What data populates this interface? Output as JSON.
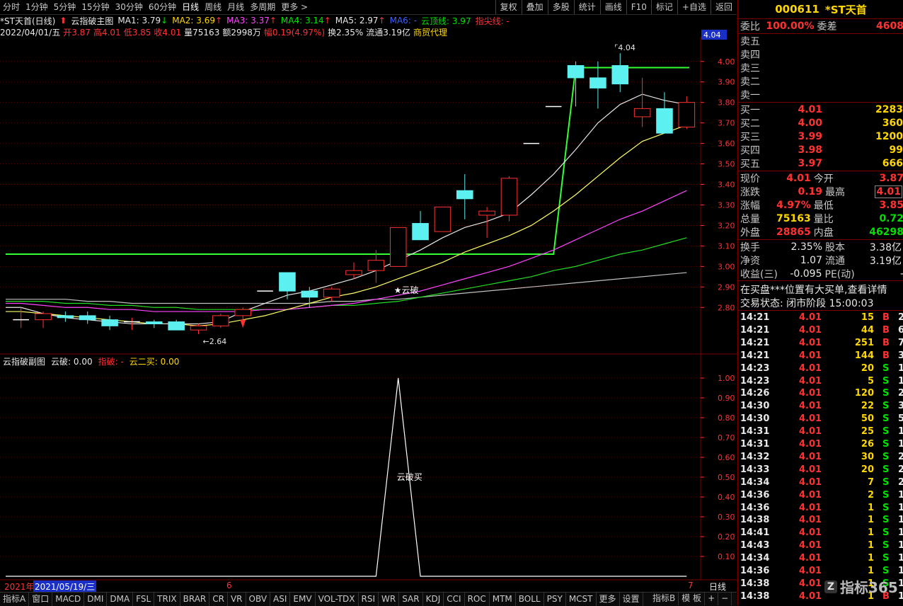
{
  "toolbar": {
    "periods": [
      "分时",
      "1分钟",
      "5分钟",
      "15分钟",
      "30分钟",
      "60分钟",
      "日线",
      "周线",
      "月线",
      "多周期",
      "更多 >"
    ],
    "active_period": "日线",
    "right_buttons": [
      "复权",
      "叠加",
      "多股",
      "统计",
      "画线",
      "F10",
      "标记",
      "+自选",
      "返回"
    ]
  },
  "main_info": {
    "title": "*ST天首(日线)",
    "indicator": "云指破主图",
    "ma1": "MA1: 3.79",
    "ma2": "MA2: 3.69",
    "ma3": "MA3: 3.37",
    "ma4": "MA4: 3.14",
    "ma5": "MA5: 2.97",
    "ma6": "MA6: -",
    "yunding": "云顶线: 3.97",
    "zhijian": "指尖线: -",
    "date": "2022/04/01/五",
    "open": "开3.87",
    "high": "高4.01",
    "low": "低3.85",
    "close": "收4.01",
    "volume": "量75163",
    "amount": "额2998万",
    "change": "幅0.19(4.97%)",
    "turnover": "换2.35%",
    "float_cap": "流通3.19亿",
    "sector": "商贸代理"
  },
  "sub_info": {
    "indicator": "云指破副图",
    "yunpo": "云破: 0.00",
    "zhipo": "指破: -",
    "yuner": "云二买: 0.00"
  },
  "colors": {
    "up": "#ff3232",
    "down": "#5cf0f0",
    "ma1": "#e8e8e8",
    "ma2": "#ffff66",
    "ma3": "#ff44ff",
    "ma4": "#22dd22",
    "ma5": "#c0c0c0",
    "cloud_top": "#33ff33"
  },
  "chart_data": [
    {
      "type": "candlestick",
      "ylim": [
        2.58,
        4.12
      ],
      "yticks": [
        "4.00",
        "3.90",
        "3.80",
        "3.70",
        "3.60",
        "3.50",
        "3.40",
        "3.30",
        "3.20",
        "3.10",
        "3.00",
        "2.90",
        "2.80"
      ],
      "ytick_values": [
        4.0,
        3.9,
        3.8,
        3.7,
        3.6,
        3.5,
        3.4,
        3.3,
        3.2,
        3.1,
        3.0,
        2.9,
        2.8
      ],
      "current_price_label": "4.04",
      "high_label": "4.04",
      "low_label": "2.64",
      "annotation": "★云破",
      "candles": [
        {
          "o": 2.74,
          "h": 2.8,
          "l": 2.7,
          "c": 2.74
        },
        {
          "o": 2.74,
          "h": 2.78,
          "l": 2.7,
          "c": 2.77
        },
        {
          "o": 2.76,
          "h": 2.78,
          "l": 2.73,
          "c": 2.75
        },
        {
          "o": 2.76,
          "h": 2.78,
          "l": 2.72,
          "c": 2.74
        },
        {
          "o": 2.74,
          "h": 2.76,
          "l": 2.69,
          "c": 2.71
        },
        {
          "o": 2.73,
          "h": 2.75,
          "l": 2.69,
          "c": 2.73
        },
        {
          "o": 2.73,
          "h": 2.74,
          "l": 2.7,
          "c": 2.72
        },
        {
          "o": 2.73,
          "h": 2.74,
          "l": 2.69,
          "c": 2.69
        },
        {
          "o": 2.69,
          "h": 2.72,
          "l": 2.67,
          "c": 2.71
        },
        {
          "o": 2.71,
          "h": 2.77,
          "l": 2.7,
          "c": 2.76
        },
        {
          "o": 2.76,
          "h": 2.8,
          "l": 2.73,
          "c": 2.79
        },
        {
          "o": 2.88,
          "h": 2.88,
          "l": 2.88,
          "c": 2.88
        },
        {
          "o": 2.97,
          "h": 2.97,
          "l": 2.84,
          "c": 2.88
        },
        {
          "o": 2.88,
          "h": 2.9,
          "l": 2.8,
          "c": 2.85
        },
        {
          "o": 2.85,
          "h": 2.9,
          "l": 2.83,
          "c": 2.89
        },
        {
          "o": 2.96,
          "h": 3.02,
          "l": 2.94,
          "c": 2.98
        },
        {
          "o": 2.98,
          "h": 3.08,
          "l": 2.92,
          "c": 3.03
        },
        {
          "o": 3.0,
          "h": 3.19,
          "l": 3.0,
          "c": 3.19
        },
        {
          "o": 3.21,
          "h": 3.27,
          "l": 3.13,
          "c": 3.13
        },
        {
          "o": 3.17,
          "h": 3.29,
          "l": 3.17,
          "c": 3.29
        },
        {
          "o": 3.37,
          "h": 3.45,
          "l": 3.23,
          "c": 3.33
        },
        {
          "o": 3.25,
          "h": 3.29,
          "l": 3.14,
          "c": 3.27
        },
        {
          "o": 3.25,
          "h": 3.44,
          "l": 3.22,
          "c": 3.43
        },
        {
          "o": 3.6,
          "h": 3.6,
          "l": 3.6,
          "c": 3.6
        },
        {
          "o": 3.78,
          "h": 3.78,
          "l": 3.78,
          "c": 3.78
        },
        {
          "o": 3.98,
          "h": 4.0,
          "l": 3.78,
          "c": 3.92
        },
        {
          "o": 3.92,
          "h": 4.0,
          "l": 3.77,
          "c": 3.87
        },
        {
          "o": 3.98,
          "h": 4.04,
          "l": 3.85,
          "c": 3.89
        },
        {
          "o": 3.73,
          "h": 3.92,
          "l": 3.68,
          "c": 3.77
        },
        {
          "o": 3.77,
          "h": 3.85,
          "l": 3.66,
          "c": 3.65
        },
        {
          "o": 3.68,
          "h": 3.83,
          "l": 3.67,
          "c": 3.8
        }
      ],
      "ma1": [
        2.8,
        2.77,
        2.75,
        2.74,
        2.73,
        2.72,
        2.72,
        2.72,
        2.72,
        2.73,
        2.78,
        2.82,
        2.86,
        2.88,
        2.91,
        2.94,
        2.98,
        3.03,
        3.08,
        3.14,
        3.19,
        3.22,
        3.26,
        3.35,
        3.45,
        3.57,
        3.7,
        3.79,
        3.84,
        3.81,
        3.79
      ],
      "ma2": [
        2.78,
        2.77,
        2.76,
        2.75,
        2.74,
        2.73,
        2.72,
        2.72,
        2.71,
        2.72,
        2.74,
        2.76,
        2.79,
        2.82,
        2.85,
        2.87,
        2.9,
        2.94,
        2.98,
        3.02,
        3.07,
        3.11,
        3.15,
        3.2,
        3.27,
        3.35,
        3.44,
        3.53,
        3.61,
        3.65,
        3.69
      ],
      "ma3": [
        2.82,
        2.81,
        2.8,
        2.8,
        2.79,
        2.79,
        2.78,
        2.78,
        2.78,
        2.78,
        2.78,
        2.79,
        2.79,
        2.8,
        2.81,
        2.82,
        2.84,
        2.86,
        2.88,
        2.91,
        2.94,
        2.97,
        3.0,
        3.04,
        3.08,
        3.13,
        3.18,
        3.23,
        3.27,
        3.32,
        3.37
      ],
      "ma4": [
        2.83,
        2.83,
        2.82,
        2.82,
        2.81,
        2.81,
        2.8,
        2.8,
        2.79,
        2.79,
        2.79,
        2.79,
        2.79,
        2.8,
        2.81,
        2.81,
        2.82,
        2.83,
        2.85,
        2.87,
        2.89,
        2.91,
        2.93,
        2.95,
        2.98,
        3.0,
        3.03,
        3.06,
        3.08,
        3.11,
        3.14
      ],
      "ma5": [
        2.84,
        2.84,
        2.84,
        2.83,
        2.83,
        2.82,
        2.82,
        2.82,
        2.82,
        2.82,
        2.82,
        2.82,
        2.82,
        2.82,
        2.83,
        2.83,
        2.84,
        2.84,
        2.85,
        2.86,
        2.87,
        2.88,
        2.89,
        2.9,
        2.91,
        2.92,
        2.93,
        2.94,
        2.95,
        2.96,
        2.97
      ],
      "cloud_top": [
        3.06,
        3.06,
        3.06,
        3.06,
        3.06,
        3.06,
        3.06,
        3.06,
        3.06,
        3.06,
        3.06,
        3.06,
        3.06,
        3.06,
        3.06,
        3.06,
        3.06,
        3.06,
        3.06,
        3.06,
        3.06,
        3.06,
        3.06,
        3.06,
        3.06,
        3.97,
        3.97,
        3.97,
        3.97,
        3.97,
        3.97
      ]
    },
    {
      "type": "line",
      "ylim": [
        0,
        1.05
      ],
      "yticks": [
        "1.00",
        "0.90",
        "0.80",
        "0.70",
        "0.60",
        "0.50",
        "0.40",
        "0.30",
        "0.20",
        "0.10"
      ],
      "ytick_values": [
        1.0,
        0.9,
        0.8,
        0.7,
        0.6,
        0.5,
        0.4,
        0.3,
        0.2,
        0.1
      ],
      "annotation": "云破买",
      "values": [
        0,
        0,
        0,
        0,
        0,
        0,
        0,
        0,
        0,
        0,
        0,
        0,
        0,
        0,
        0,
        0,
        0,
        1.0,
        0,
        0,
        0,
        0,
        0,
        0,
        0,
        0,
        0,
        0,
        0,
        0,
        0
      ]
    }
  ],
  "date_axis": {
    "labels": [
      "2021年",
      "2021/05/19/三",
      "6",
      "7"
    ],
    "tab": "日线"
  },
  "bottom_tabs": [
    "指标A",
    "窗口",
    "MACD",
    "DMI",
    "DMA",
    "FSL",
    "TRIX",
    "BRAR",
    "CR",
    "VR",
    "OBV",
    "ASI",
    "EMV",
    "VOL-TDX",
    "RSI",
    "WR",
    "SAR",
    "KDJ",
    "CCI",
    "ROC",
    "MTM",
    "BOLL",
    "PSY",
    "MCST",
    "更多",
    "设置"
  ],
  "bottom_right": [
    "指标B",
    "模 板",
    "+",
    "−"
  ],
  "panel": {
    "code": "000611",
    "name": "*ST天首",
    "weibi_label": "委比",
    "weibi": "100.00%",
    "weicha_label": "委差",
    "weicha": "4608",
    "sell": [
      {
        "label": "卖五",
        "price": "",
        "vol": ""
      },
      {
        "label": "卖四",
        "price": "",
        "vol": ""
      },
      {
        "label": "卖三",
        "price": "",
        "vol": ""
      },
      {
        "label": "卖二",
        "price": "",
        "vol": ""
      },
      {
        "label": "卖一",
        "price": "",
        "vol": ""
      }
    ],
    "buy": [
      {
        "label": "买一",
        "price": "4.01",
        "vol": "2283"
      },
      {
        "label": "买二",
        "price": "4.00",
        "vol": "360"
      },
      {
        "label": "买三",
        "price": "3.99",
        "vol": "1200"
      },
      {
        "label": "买四",
        "price": "3.98",
        "vol": "99"
      },
      {
        "label": "买五",
        "price": "3.97",
        "vol": "666"
      }
    ],
    "stats": [
      {
        "l1": "现价",
        "v1": "4.01",
        "l2": "今开",
        "v2": "3.87",
        "c1": "red",
        "c2": "red"
      },
      {
        "l1": "涨跌",
        "v1": "0.19",
        "l2": "最高",
        "v2": "4.01",
        "c1": "red",
        "c2": "red"
      },
      {
        "l1": "涨幅",
        "v1": "4.97%",
        "l2": "最低",
        "v2": "3.85",
        "c1": "red",
        "c2": "red"
      },
      {
        "l1": "总量",
        "v1": "75163",
        "l2": "量比",
        "v2": "0.72",
        "c1": "yellow",
        "c2": "green"
      },
      {
        "l1": "外盘",
        "v1": "28865",
        "l2": "内盘",
        "v2": "46298",
        "c1": "red",
        "c2": "green"
      }
    ],
    "stats2": [
      {
        "l1": "换手",
        "v1": "2.35%",
        "l2": "股本",
        "v2": "3.38亿"
      },
      {
        "l1": "净资",
        "v1": "1.07",
        "l2": "流通",
        "v2": "3.19亿"
      },
      {
        "l1": "收益(三)",
        "v1": "-0.095",
        "l2": "PE(动)",
        "v2": "-"
      }
    ],
    "message": "在买盘***位置有大买单,查看详情",
    "status": "交易状态: 闭市阶段 15:00:03",
    "ticks": [
      {
        "t": "14:21",
        "p": "4.01",
        "v": "15",
        "d": "B",
        "n": "2"
      },
      {
        "t": "14:21",
        "p": "4.01",
        "v": "44",
        "d": "B",
        "n": "6"
      },
      {
        "t": "14:21",
        "p": "4.01",
        "v": "251",
        "d": "B",
        "n": "7"
      },
      {
        "t": "14:21",
        "p": "4.01",
        "v": "144",
        "d": "B",
        "n": "3"
      },
      {
        "t": "14:23",
        "p": "4.01",
        "v": "20",
        "d": "S",
        "n": "1"
      },
      {
        "t": "14:23",
        "p": "4.01",
        "v": "5",
        "d": "S",
        "n": "1"
      },
      {
        "t": "14:26",
        "p": "4.01",
        "v": "120",
        "d": "S",
        "n": "2"
      },
      {
        "t": "14:30",
        "p": "4.01",
        "v": "22",
        "d": "S",
        "n": "3"
      },
      {
        "t": "14:30",
        "p": "4.01",
        "v": "50",
        "d": "S",
        "n": "5"
      },
      {
        "t": "14:31",
        "p": "4.01",
        "v": "25",
        "d": "S",
        "n": "1"
      },
      {
        "t": "14:31",
        "p": "4.01",
        "v": "26",
        "d": "S",
        "n": "1"
      },
      {
        "t": "14:32",
        "p": "4.01",
        "v": "30",
        "d": "S",
        "n": "2"
      },
      {
        "t": "14:33",
        "p": "4.01",
        "v": "20",
        "d": "S",
        "n": "2"
      },
      {
        "t": "14:34",
        "p": "4.01",
        "v": "7",
        "d": "S",
        "n": "2"
      },
      {
        "t": "14:36",
        "p": "4.01",
        "v": "2",
        "d": "S",
        "n": "1"
      },
      {
        "t": "14:36",
        "p": "4.01",
        "v": "1",
        "d": "S",
        "n": "1"
      },
      {
        "t": "14:38",
        "p": "4.01",
        "v": "1",
        "d": "S",
        "n": "1"
      },
      {
        "t": "14:41",
        "p": "4.01",
        "v": "1",
        "d": "S",
        "n": "1"
      },
      {
        "t": "14:43",
        "p": "4.01",
        "v": "1",
        "d": "S",
        "n": "1"
      },
      {
        "t": "14:34",
        "p": "4.01",
        "v": "1",
        "d": "S",
        "n": "1"
      },
      {
        "t": "14:36",
        "p": "4.01",
        "v": "1",
        "d": "S",
        "n": "1"
      },
      {
        "t": "14:38",
        "p": "4.01",
        "v": "1",
        "d": "S",
        "n": "1"
      },
      {
        "t": "14:38",
        "p": "4.01",
        "v": "1",
        "d": "B",
        "n": "1"
      }
    ],
    "watermark": "指标365"
  }
}
